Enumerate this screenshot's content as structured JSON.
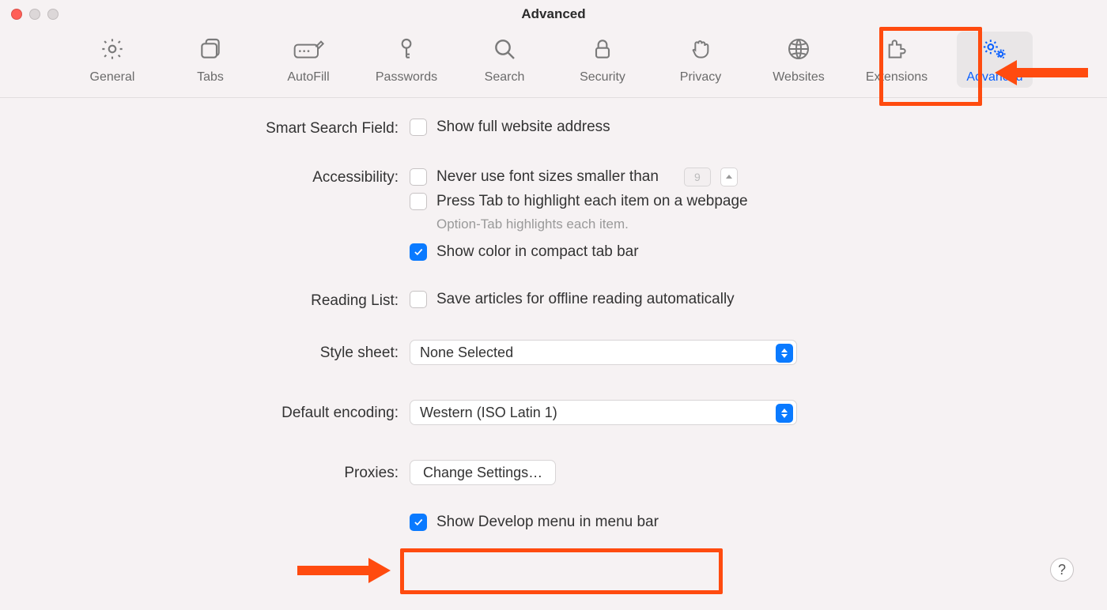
{
  "window": {
    "title": "Advanced"
  },
  "toolbar": {
    "items": [
      {
        "id": "general",
        "label": "General"
      },
      {
        "id": "tabs",
        "label": "Tabs"
      },
      {
        "id": "autofill",
        "label": "AutoFill"
      },
      {
        "id": "passwords",
        "label": "Passwords"
      },
      {
        "id": "search",
        "label": "Search"
      },
      {
        "id": "security",
        "label": "Security"
      },
      {
        "id": "privacy",
        "label": "Privacy"
      },
      {
        "id": "websites",
        "label": "Websites"
      },
      {
        "id": "extensions",
        "label": "Extensions"
      },
      {
        "id": "advanced",
        "label": "Advanced",
        "active": true
      }
    ]
  },
  "sections": {
    "smart_search": {
      "label": "Smart Search Field:",
      "show_full_address": {
        "text": "Show full website address",
        "checked": false
      }
    },
    "accessibility": {
      "label": "Accessibility:",
      "never_font_smaller": {
        "text": "Never use font sizes smaller than",
        "checked": false,
        "value": "9"
      },
      "press_tab": {
        "text": "Press Tab to highlight each item on a webpage",
        "checked": false
      },
      "hint": "Option-Tab highlights each item.",
      "show_color": {
        "text": "Show color in compact tab bar",
        "checked": true
      }
    },
    "reading_list": {
      "label": "Reading List:",
      "save_offline": {
        "text": "Save articles for offline reading automatically",
        "checked": false
      }
    },
    "style_sheet": {
      "label": "Style sheet:",
      "value": "None Selected"
    },
    "default_encoding": {
      "label": "Default encoding:",
      "value": "Western (ISO Latin 1)"
    },
    "proxies": {
      "label": "Proxies:",
      "button": "Change Settings…"
    },
    "develop": {
      "text": "Show Develop menu in menu bar",
      "checked": true
    }
  },
  "help_button": "?"
}
